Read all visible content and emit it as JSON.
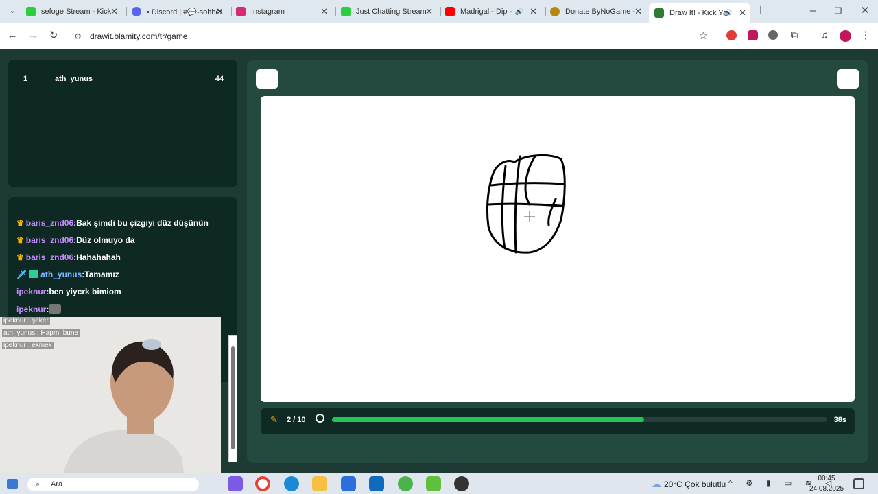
{
  "browser": {
    "tabs": [
      {
        "title": "sefoge Stream - Kick",
        "color": "#2ecc40"
      },
      {
        "title": "• Discord | #💬-sohbet",
        "color": "#5865f2"
      },
      {
        "title": "Instagram",
        "color": "#d62976"
      },
      {
        "title": "Just Chatting Stream",
        "color": "#2ecc40"
      },
      {
        "title": "Madrigal - Dip - ",
        "color": "#ff0000"
      },
      {
        "title": "Donate ByNoGame -",
        "color": "#b8860b"
      },
      {
        "title": "Draw It! - Kick Ya",
        "color": "#2e7d32"
      }
    ],
    "url": "drawit.blamity.com/tr/game"
  },
  "leaderboard": [
    {
      "rank": "1",
      "name": "ath_yunus",
      "score": "44"
    }
  ],
  "chat": [
    {
      "user": "baris_znd06",
      "text": "Bak şimdi bu çizgiyi düz düşünün",
      "badge": "crown"
    },
    {
      "user": "baris_znd06",
      "text": "Düz olmuyo da",
      "badge": "crown"
    },
    {
      "user": "baris_znd06",
      "text": "Hahahahah",
      "badge": "crown"
    },
    {
      "user": "ath_yunus",
      "text": "Tamamız",
      "badge": "sword"
    },
    {
      "user": "ipeknur",
      "text": "ben yiycrk bimiom",
      "badge": ""
    },
    {
      "user": "ipeknur",
      "text": "",
      "badge": "",
      "emote": true
    }
  ],
  "game": {
    "round": "2 / 10",
    "timer": "38s",
    "progress": 0.63
  },
  "stream_overlay": {
    "lines": [
      "ipeknur : şeker",
      "ath_yunus : Hapmı bune",
      "ipeknur : ekmek"
    ]
  },
  "taskbar": {
    "search": "Ara",
    "weather": "20°C  Çok bulutlu",
    "time": "00:45",
    "date": "24.08.2025"
  }
}
